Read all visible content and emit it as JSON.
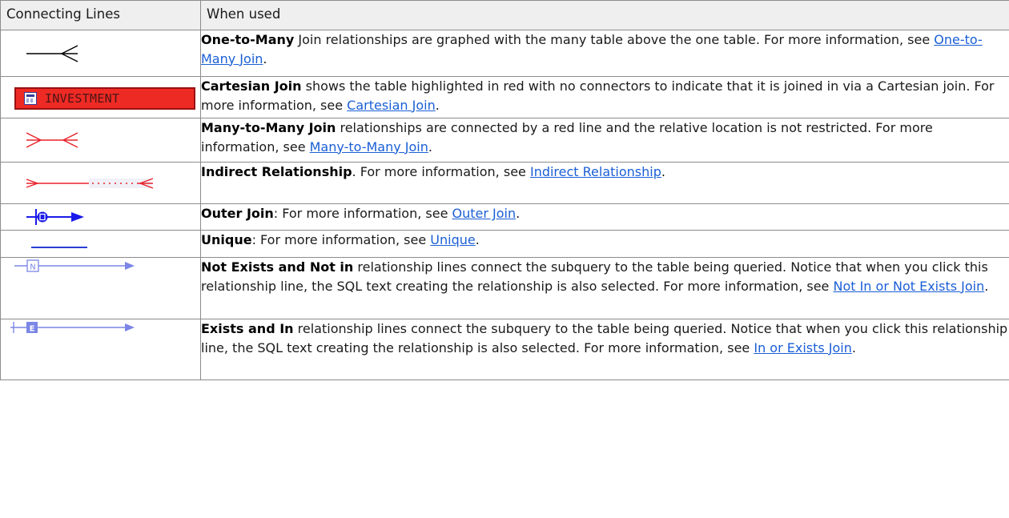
{
  "table": {
    "header": {
      "col1": "Connecting Lines",
      "col2": "When used"
    },
    "rows": [
      {
        "term": "One-to-Many",
        "text": "  Join relationships are graphed with the many table above the one table. For more information, see ",
        "link": "One-to-Many Join",
        "tail": "."
      },
      {
        "symbol_label": "INVESTMENT",
        "term": "Cartesian  Join",
        "text": " shows the table highlighted in red with no connectors to indicate that it is joined in via a Cartesian join. For more information, see ",
        "link": "Cartesian Join",
        "tail": "."
      },
      {
        "term": "Many-to-Many Join",
        "text": " relationships are connected by a red line and the relative location is not restricted. For more information, see ",
        "link": "Many-to-Many Join",
        "tail": "."
      },
      {
        "term": "Indirect Relationship",
        "text": ".  For more information, see ",
        "link": "Indirect Relationship",
        "tail": "."
      },
      {
        "term": "Outer  Join",
        "text": ": For more information, see ",
        "link": "Outer Join",
        "tail": "."
      },
      {
        "term": "Unique",
        "text": ": For more information, see ",
        "link": "Unique",
        "tail": "."
      },
      {
        "term": "Not Exists and Not in",
        "text": " relationship lines connect the subquery to the table being queried. Notice that when you click this relationship line, the SQL text creating the relationship is also selected. For more information, see ",
        "link": "Not In or Not Exists Join",
        "tail": "."
      },
      {
        "term": "Exists and In",
        "text": " relationship lines connect the subquery to the table being queried. Notice that when you click this relationship line, the SQL text creating the relationship is also selected. For more information, see ",
        "link": "In or Exists Join",
        "tail": "."
      }
    ]
  },
  "icons": {
    "one_to_many": "one-to-many-line-icon",
    "cartesian": "cartesian-table-icon",
    "many_to_many": "many-to-many-line-icon",
    "indirect": "indirect-relationship-line-icon",
    "outer_join": "outer-join-line-icon",
    "unique": "unique-line-icon",
    "not_exists": "not-exists-line-icon",
    "exists": "exists-line-icon"
  },
  "colors": {
    "link": "#1a5fd6",
    "red_line": "#e8202a",
    "outer_join_blue": "#1a1ae8",
    "unique_blue": "#2a3fd6",
    "exists_lilac": "#7b86e6",
    "cartesian_fill": "#ee2a24"
  }
}
